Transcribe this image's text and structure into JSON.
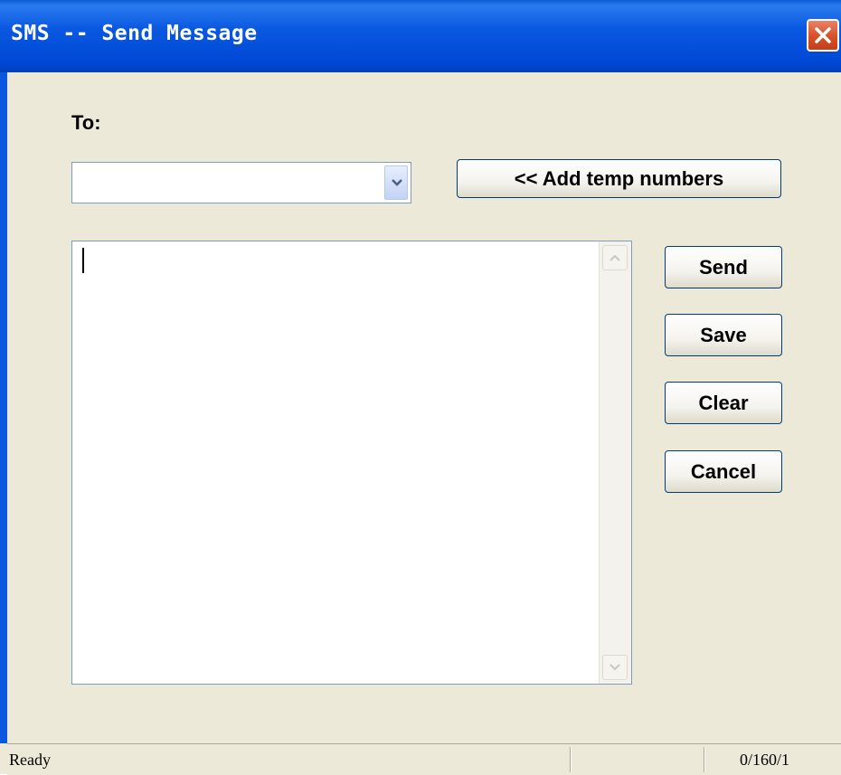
{
  "window": {
    "title": "SMS -- Send Message"
  },
  "form": {
    "to_label": "To:",
    "recipient_value": "",
    "add_temp_label": "<< Add temp numbers",
    "message_text": ""
  },
  "actions": {
    "send_label": "Send",
    "save_label": "Save",
    "clear_label": "Clear",
    "cancel_label": "Cancel"
  },
  "status": {
    "text": "Ready",
    "counter": "0/160/1"
  },
  "icons": {
    "close": "close-icon",
    "dropdown": "chevron-down-icon",
    "scroll_up": "arrow-up-icon",
    "scroll_down": "arrow-down-icon"
  },
  "colors": {
    "titlebar": "#0a58e0",
    "close": "#d9532d",
    "dialog_bg": "#ece9d8",
    "field_border": "#7f9db9",
    "button_border": "#003c74"
  }
}
